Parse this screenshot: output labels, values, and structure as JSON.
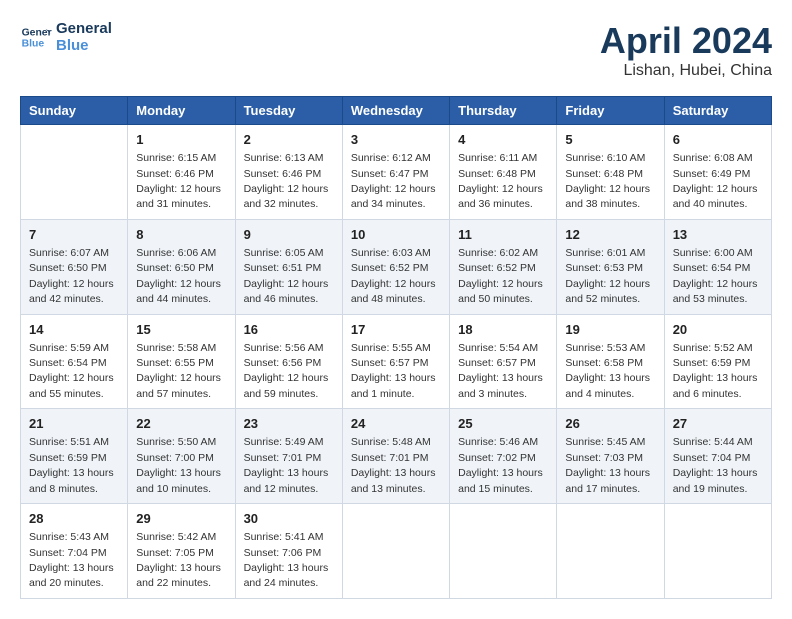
{
  "logo": {
    "line1": "General",
    "line2": "Blue"
  },
  "title": "April 2024",
  "subtitle": "Lishan, Hubei, China",
  "headers": [
    "Sunday",
    "Monday",
    "Tuesday",
    "Wednesday",
    "Thursday",
    "Friday",
    "Saturday"
  ],
  "weeks": [
    [
      {
        "day": "",
        "info": ""
      },
      {
        "day": "1",
        "info": "Sunrise: 6:15 AM\nSunset: 6:46 PM\nDaylight: 12 hours\nand 31 minutes."
      },
      {
        "day": "2",
        "info": "Sunrise: 6:13 AM\nSunset: 6:46 PM\nDaylight: 12 hours\nand 32 minutes."
      },
      {
        "day": "3",
        "info": "Sunrise: 6:12 AM\nSunset: 6:47 PM\nDaylight: 12 hours\nand 34 minutes."
      },
      {
        "day": "4",
        "info": "Sunrise: 6:11 AM\nSunset: 6:48 PM\nDaylight: 12 hours\nand 36 minutes."
      },
      {
        "day": "5",
        "info": "Sunrise: 6:10 AM\nSunset: 6:48 PM\nDaylight: 12 hours\nand 38 minutes."
      },
      {
        "day": "6",
        "info": "Sunrise: 6:08 AM\nSunset: 6:49 PM\nDaylight: 12 hours\nand 40 minutes."
      }
    ],
    [
      {
        "day": "7",
        "info": "Sunrise: 6:07 AM\nSunset: 6:50 PM\nDaylight: 12 hours\nand 42 minutes."
      },
      {
        "day": "8",
        "info": "Sunrise: 6:06 AM\nSunset: 6:50 PM\nDaylight: 12 hours\nand 44 minutes."
      },
      {
        "day": "9",
        "info": "Sunrise: 6:05 AM\nSunset: 6:51 PM\nDaylight: 12 hours\nand 46 minutes."
      },
      {
        "day": "10",
        "info": "Sunrise: 6:03 AM\nSunset: 6:52 PM\nDaylight: 12 hours\nand 48 minutes."
      },
      {
        "day": "11",
        "info": "Sunrise: 6:02 AM\nSunset: 6:52 PM\nDaylight: 12 hours\nand 50 minutes."
      },
      {
        "day": "12",
        "info": "Sunrise: 6:01 AM\nSunset: 6:53 PM\nDaylight: 12 hours\nand 52 minutes."
      },
      {
        "day": "13",
        "info": "Sunrise: 6:00 AM\nSunset: 6:54 PM\nDaylight: 12 hours\nand 53 minutes."
      }
    ],
    [
      {
        "day": "14",
        "info": "Sunrise: 5:59 AM\nSunset: 6:54 PM\nDaylight: 12 hours\nand 55 minutes."
      },
      {
        "day": "15",
        "info": "Sunrise: 5:58 AM\nSunset: 6:55 PM\nDaylight: 12 hours\nand 57 minutes."
      },
      {
        "day": "16",
        "info": "Sunrise: 5:56 AM\nSunset: 6:56 PM\nDaylight: 12 hours\nand 59 minutes."
      },
      {
        "day": "17",
        "info": "Sunrise: 5:55 AM\nSunset: 6:57 PM\nDaylight: 13 hours\nand 1 minute."
      },
      {
        "day": "18",
        "info": "Sunrise: 5:54 AM\nSunset: 6:57 PM\nDaylight: 13 hours\nand 3 minutes."
      },
      {
        "day": "19",
        "info": "Sunrise: 5:53 AM\nSunset: 6:58 PM\nDaylight: 13 hours\nand 4 minutes."
      },
      {
        "day": "20",
        "info": "Sunrise: 5:52 AM\nSunset: 6:59 PM\nDaylight: 13 hours\nand 6 minutes."
      }
    ],
    [
      {
        "day": "21",
        "info": "Sunrise: 5:51 AM\nSunset: 6:59 PM\nDaylight: 13 hours\nand 8 minutes."
      },
      {
        "day": "22",
        "info": "Sunrise: 5:50 AM\nSunset: 7:00 PM\nDaylight: 13 hours\nand 10 minutes."
      },
      {
        "day": "23",
        "info": "Sunrise: 5:49 AM\nSunset: 7:01 PM\nDaylight: 13 hours\nand 12 minutes."
      },
      {
        "day": "24",
        "info": "Sunrise: 5:48 AM\nSunset: 7:01 PM\nDaylight: 13 hours\nand 13 minutes."
      },
      {
        "day": "25",
        "info": "Sunrise: 5:46 AM\nSunset: 7:02 PM\nDaylight: 13 hours\nand 15 minutes."
      },
      {
        "day": "26",
        "info": "Sunrise: 5:45 AM\nSunset: 7:03 PM\nDaylight: 13 hours\nand 17 minutes."
      },
      {
        "day": "27",
        "info": "Sunrise: 5:44 AM\nSunset: 7:04 PM\nDaylight: 13 hours\nand 19 minutes."
      }
    ],
    [
      {
        "day": "28",
        "info": "Sunrise: 5:43 AM\nSunset: 7:04 PM\nDaylight: 13 hours\nand 20 minutes."
      },
      {
        "day": "29",
        "info": "Sunrise: 5:42 AM\nSunset: 7:05 PM\nDaylight: 13 hours\nand 22 minutes."
      },
      {
        "day": "30",
        "info": "Sunrise: 5:41 AM\nSunset: 7:06 PM\nDaylight: 13 hours\nand 24 minutes."
      },
      {
        "day": "",
        "info": ""
      },
      {
        "day": "",
        "info": ""
      },
      {
        "day": "",
        "info": ""
      },
      {
        "day": "",
        "info": ""
      }
    ]
  ]
}
